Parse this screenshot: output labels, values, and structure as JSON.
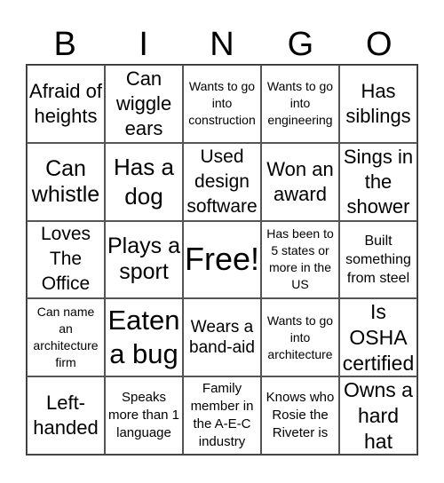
{
  "header": [
    "B",
    "I",
    "N",
    "G",
    "O"
  ],
  "cells": [
    [
      "Afraid of heights",
      "Can wiggle ears",
      "Wants to go into construction",
      "Wants to go into engineering",
      "Has siblings"
    ],
    [
      "Can whistle",
      "Has a dog",
      "Used design software",
      "Won an award",
      "Sings in the shower"
    ],
    [
      "Loves The Office",
      "Plays a sport",
      "Free!",
      "Has been to 5 states or more in the US",
      "Built something from steel"
    ],
    [
      "Can name an architecture firm",
      "Eaten a bug",
      "Wears a band-aid",
      "Wants to go into architecture",
      "Is OSHA certified"
    ],
    [
      "Left-handed",
      "Speaks more than 1 language",
      "Family member in the A-E-C industry",
      "Knows who Rosie the Riveter is",
      "Owns a hard hat"
    ]
  ]
}
